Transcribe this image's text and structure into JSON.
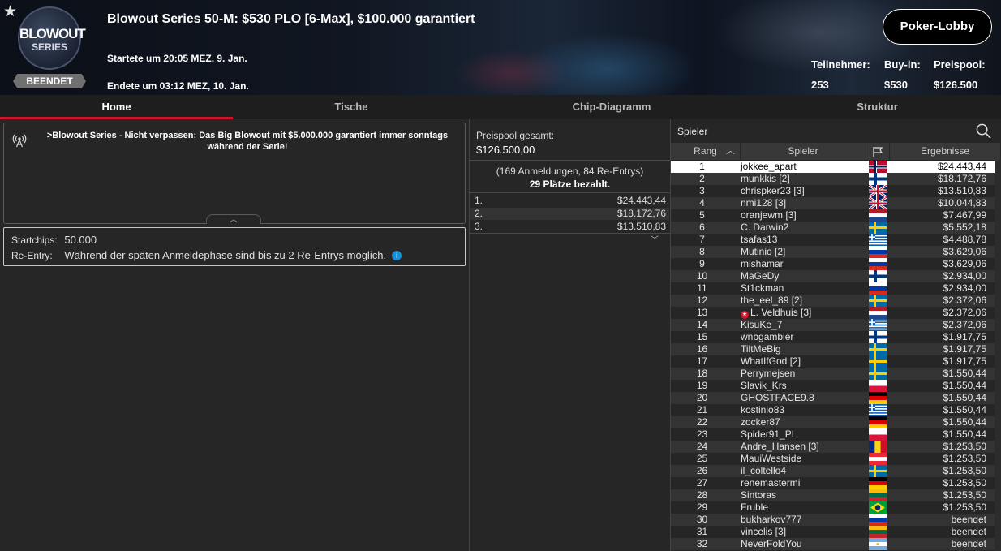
{
  "header": {
    "favorite_icon": "star-icon",
    "logo_line1": "BLOWOUT",
    "logo_line2": "SERIES",
    "status_badge": "BEENDET",
    "title": "Blowout Series 50-M: $530 PLO [6-Max], $100.000 garantiert",
    "started": "Startete um 20:05 MEZ, 9. Jan.",
    "ended": "Endete um 03:12 MEZ, 10. Jan.",
    "lobby_button": "Poker-Lobby",
    "stats": [
      {
        "label": "Teilnehmer:",
        "value": "253"
      },
      {
        "label": "Buy-in:",
        "value": "$530"
      },
      {
        "label": "Preispool:",
        "value": "$126.500"
      }
    ]
  },
  "tabs": [
    "Home",
    "Tische",
    "Chip-Diagramm",
    "Struktur"
  ],
  "news": {
    "icon": "broadcast-icon",
    "text": ">Blowout Series - Nicht verpassen: Das Big Blowout mit $5.000.000 garantiert immer sonntags während der Serie!"
  },
  "info": {
    "startchips_label": "Startchips:",
    "startchips_value": "50.000",
    "reentry_label": "Re-Entry:",
    "reentry_value": "Während der späten Anmeldephase sind bis zu 2 Re-Entrys möglich.",
    "info_icon": "i"
  },
  "prizepool": {
    "label": "Preispool gesamt:",
    "value": "$126.500,00",
    "entries": "(169 Anmeldungen, 84 Re-Entrys)",
    "paid": "29 Plätze bezahlt.",
    "prizes": [
      {
        "pos": "1.",
        "amount": "$24.443,44"
      },
      {
        "pos": "2.",
        "amount": "$18.172,76"
      },
      {
        "pos": "3.",
        "amount": "$13.510,83"
      }
    ]
  },
  "players_panel": {
    "search_placeholder": "Spieler",
    "columns": {
      "rank": "Rang",
      "player": "Spieler",
      "result": "Ergebnisse"
    },
    "rows": [
      {
        "rank": "1",
        "name": "jokkee_apart",
        "flag": "norway",
        "result": "$24.443,44"
      },
      {
        "rank": "2",
        "name": "munkkis [2]",
        "flag": "finland",
        "result": "$18.172,76"
      },
      {
        "rank": "3",
        "name": "chrispker23 [3]",
        "flag": "uk",
        "result": "$13.510,83"
      },
      {
        "rank": "4",
        "name": "nmi128 [3]",
        "flag": "uk",
        "result": "$10.044,83"
      },
      {
        "rank": "5",
        "name": "oranjewm [3]",
        "flag": "netherlands",
        "result": "$7.467,99"
      },
      {
        "rank": "6",
        "name": "C. Darwin2",
        "flag": "sweden",
        "result": "$5.552,18"
      },
      {
        "rank": "7",
        "name": "tsafas13",
        "flag": "greece",
        "result": "$4.488,78"
      },
      {
        "rank": "8",
        "name": "Mutinio [2]",
        "flag": "russia",
        "result": "$3.629,06"
      },
      {
        "rank": "9",
        "name": "mishamar",
        "flag": "russia",
        "result": "$3.629,06"
      },
      {
        "rank": "10",
        "name": "MaGeDy",
        "flag": "finland",
        "result": "$2.934,00"
      },
      {
        "rank": "11",
        "name": "St1ckman",
        "flag": "russia",
        "result": "$2.934,00"
      },
      {
        "rank": "12",
        "name": "the_eel_89 [2]",
        "flag": "sweden",
        "result": "$2.372,06"
      },
      {
        "rank": "13",
        "name": "L. Veldhuis [3]",
        "flag": "netherlands",
        "result": "$2.372,06",
        "pro": true
      },
      {
        "rank": "14",
        "name": "KisuKe_7",
        "flag": "greece",
        "result": "$2.372,06"
      },
      {
        "rank": "15",
        "name": "wnbgambler",
        "flag": "finland",
        "result": "$1.917,75"
      },
      {
        "rank": "16",
        "name": "TiltMeBig",
        "flag": "sweden",
        "result": "$1.917,75"
      },
      {
        "rank": "17",
        "name": "WhatIfGod [2]",
        "flag": "sweden",
        "result": "$1.917,75"
      },
      {
        "rank": "18",
        "name": "Perrymejsen",
        "flag": "sweden",
        "result": "$1.550,44"
      },
      {
        "rank": "19",
        "name": "Slavik_Krs",
        "flag": "poland",
        "result": "$1.550,44"
      },
      {
        "rank": "20",
        "name": "GHOSTFACE9.8",
        "flag": "germany",
        "result": "$1.550,44"
      },
      {
        "rank": "21",
        "name": "kostinio83",
        "flag": "greece",
        "result": "$1.550,44"
      },
      {
        "rank": "22",
        "name": "zocker87",
        "flag": "germany",
        "result": "$1.550,44"
      },
      {
        "rank": "23",
        "name": "Spider91_PL",
        "flag": "poland",
        "result": "$1.550,44"
      },
      {
        "rank": "24",
        "name": "Andre_Hansen [3]",
        "flag": "romania",
        "result": "$1.253,50"
      },
      {
        "rank": "25",
        "name": "MauiWestside",
        "flag": "austria",
        "result": "$1.253,50"
      },
      {
        "rank": "26",
        "name": "il_coltello4",
        "flag": "sweden",
        "result": "$1.253,50"
      },
      {
        "rank": "27",
        "name": "renemastermi",
        "flag": "germany",
        "result": "$1.253,50"
      },
      {
        "rank": "28",
        "name": "Sintoras",
        "flag": "lithuania",
        "result": "$1.253,50"
      },
      {
        "rank": "29",
        "name": "Fruble",
        "flag": "brazil",
        "result": "$1.253,50"
      },
      {
        "rank": "30",
        "name": "bukharkov777",
        "flag": "russia",
        "result": "beendet"
      },
      {
        "rank": "31",
        "name": "vincelis [3]",
        "flag": "lithuania",
        "result": "beendet"
      },
      {
        "rank": "32",
        "name": "NeverFoldYou",
        "flag": "argentina",
        "result": "beendet"
      }
    ]
  },
  "colors": {
    "accent": "#d2152a",
    "info": "#1a8fd6"
  }
}
